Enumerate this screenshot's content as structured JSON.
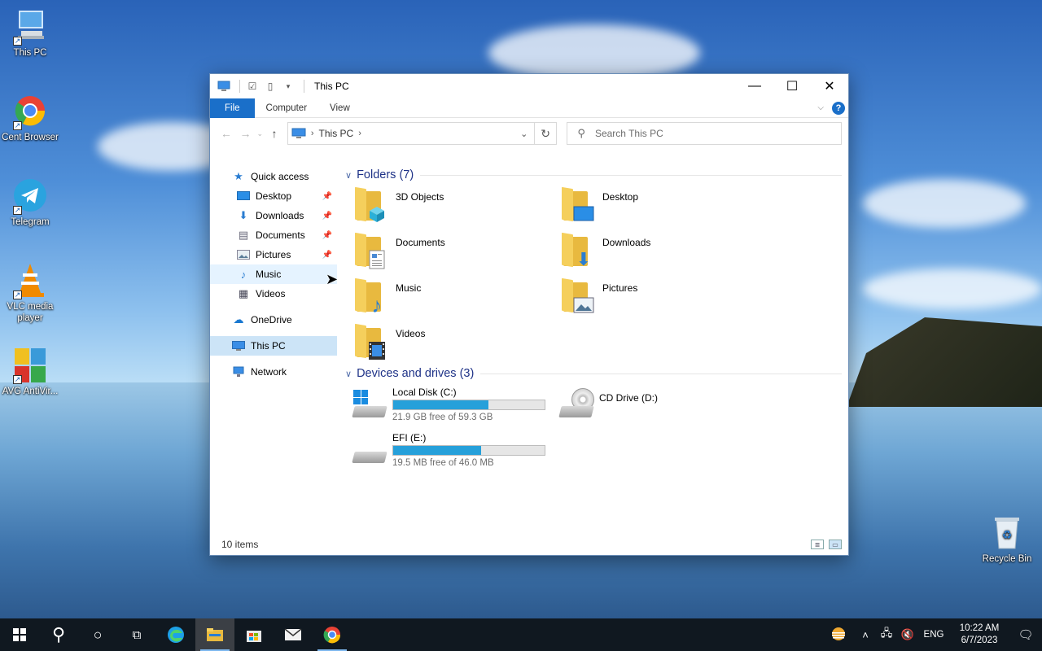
{
  "desktop": {
    "icons": [
      {
        "label": "This PC"
      },
      {
        "label": "Cent Browser"
      },
      {
        "label": "Telegram"
      },
      {
        "label": "VLC media player"
      },
      {
        "label": "AVG AntiVir..."
      },
      {
        "label": "Recycle Bin"
      }
    ]
  },
  "window": {
    "title": "This PC",
    "controls": {
      "minimize": "—",
      "maximize": "☐",
      "close": "✕"
    },
    "ribbon": {
      "tabs": [
        {
          "label": "File"
        },
        {
          "label": "Computer"
        },
        {
          "label": "View"
        }
      ],
      "help": "?"
    },
    "address": {
      "crumb": "This PC",
      "separator": "›"
    },
    "search": {
      "placeholder": "Search This PC"
    },
    "sidebar": {
      "quick_access": "Quick access",
      "pinned": [
        {
          "label": "Desktop",
          "icon": "desktop-icon"
        },
        {
          "label": "Downloads",
          "icon": "downloads-icon"
        },
        {
          "label": "Documents",
          "icon": "documents-icon"
        },
        {
          "label": "Pictures",
          "icon": "pictures-icon"
        },
        {
          "label": "Music",
          "icon": "music-icon"
        },
        {
          "label": "Videos",
          "icon": "videos-icon"
        }
      ],
      "onedrive": "OneDrive",
      "this_pc": "This PC",
      "network": "Network"
    },
    "folders": {
      "heading": "Folders (7)",
      "items": [
        {
          "label": "3D Objects"
        },
        {
          "label": "Desktop"
        },
        {
          "label": "Documents"
        },
        {
          "label": "Downloads"
        },
        {
          "label": "Music"
        },
        {
          "label": "Pictures"
        },
        {
          "label": "Videos"
        }
      ]
    },
    "drives": {
      "heading": "Devices and drives (3)",
      "items": [
        {
          "label": "Local Disk (C:)",
          "free": "21.9 GB free of 59.3 GB",
          "used_fraction": 0.63
        },
        {
          "label": "CD Drive (D:)"
        },
        {
          "label": "EFI (E:)",
          "free": "19.5 MB free of 46.0 MB",
          "used_fraction": 0.58
        }
      ]
    },
    "status": {
      "items": "10 items"
    }
  },
  "taskbar": {
    "tray": {
      "lang": "ENG",
      "time": "10:22 AM",
      "date": "6/7/2023"
    }
  },
  "colors": {
    "accent": "#1a6fc9",
    "bar_fill": "#26a0da",
    "heading": "#1e3287"
  }
}
